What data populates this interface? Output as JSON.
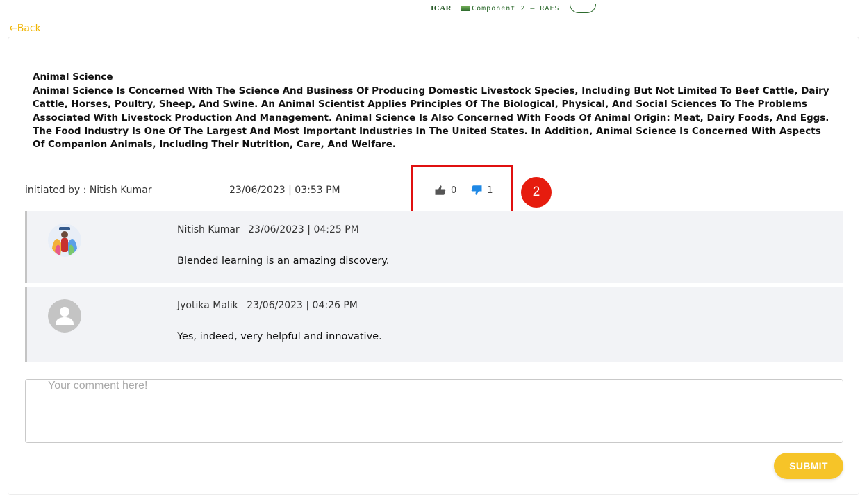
{
  "header": {
    "logo_icar": "ICAR",
    "logo_component": "Component 2 – RAES"
  },
  "nav": {
    "back_label": "←Back"
  },
  "topic": {
    "title": "Animal Science",
    "body": "Animal Science Is Concerned With The Science And Business Of Producing Domestic Livestock Species, Including But Not Limited To Beef Cattle, Dairy Cattle, Horses, Poultry, Sheep, And Swine. An Animal Scientist Applies Principles Of The Biological, Physical, And Social Sciences To The Problems Associated With Livestock Production And Management. Animal Science Is Also Concerned With Foods Of Animal Origin: Meat, Dairy Foods, And Eggs. The Food Industry Is One Of The Largest And Most Important Industries In The United States. In Addition, Animal Science Is Concerned With Aspects Of Companion Animals, Including Their Nutrition, Care, And Welfare.",
    "initiated_by": "initiated by : Nitish Kumar",
    "datetime": "23/06/2023 | 03:53 PM",
    "likes": "0",
    "dislikes": "1"
  },
  "annotation": {
    "step_number": "2"
  },
  "comments": [
    {
      "author": "Nitish Kumar",
      "datetime": "23/06/2023 | 04:25 PM",
      "text": "Blended learning is an amazing discovery.",
      "avatar": "photo-avatar"
    },
    {
      "author": "Jyotika Malik",
      "datetime": "23/06/2023 | 04:26 PM",
      "text": "Yes, indeed, very helpful and innovative.",
      "avatar": "default-user-icon"
    }
  ],
  "form": {
    "placeholder": "Your comment here!",
    "value": "",
    "submit_label": "SUBMIT"
  },
  "colors": {
    "accent": "#f6c428",
    "back_link": "#f0b400",
    "dislike_active": "#1e88e5",
    "highlight": "#e01010"
  }
}
